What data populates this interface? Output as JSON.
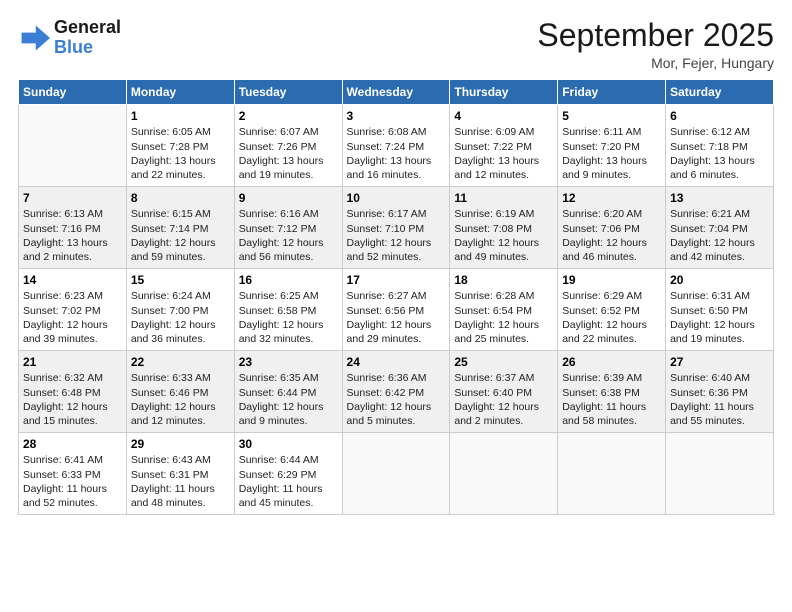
{
  "logo": {
    "line1": "General",
    "line2": "Blue"
  },
  "title": "September 2025",
  "location": "Mor, Fejer, Hungary",
  "days_header": [
    "Sunday",
    "Monday",
    "Tuesday",
    "Wednesday",
    "Thursday",
    "Friday",
    "Saturday"
  ],
  "weeks": [
    [
      {
        "day": "",
        "info": ""
      },
      {
        "day": "1",
        "info": "Sunrise: 6:05 AM\nSunset: 7:28 PM\nDaylight: 13 hours\nand 22 minutes."
      },
      {
        "day": "2",
        "info": "Sunrise: 6:07 AM\nSunset: 7:26 PM\nDaylight: 13 hours\nand 19 minutes."
      },
      {
        "day": "3",
        "info": "Sunrise: 6:08 AM\nSunset: 7:24 PM\nDaylight: 13 hours\nand 16 minutes."
      },
      {
        "day": "4",
        "info": "Sunrise: 6:09 AM\nSunset: 7:22 PM\nDaylight: 13 hours\nand 12 minutes."
      },
      {
        "day": "5",
        "info": "Sunrise: 6:11 AM\nSunset: 7:20 PM\nDaylight: 13 hours\nand 9 minutes."
      },
      {
        "day": "6",
        "info": "Sunrise: 6:12 AM\nSunset: 7:18 PM\nDaylight: 13 hours\nand 6 minutes."
      }
    ],
    [
      {
        "day": "7",
        "info": "Sunrise: 6:13 AM\nSunset: 7:16 PM\nDaylight: 13 hours\nand 2 minutes."
      },
      {
        "day": "8",
        "info": "Sunrise: 6:15 AM\nSunset: 7:14 PM\nDaylight: 12 hours\nand 59 minutes."
      },
      {
        "day": "9",
        "info": "Sunrise: 6:16 AM\nSunset: 7:12 PM\nDaylight: 12 hours\nand 56 minutes."
      },
      {
        "day": "10",
        "info": "Sunrise: 6:17 AM\nSunset: 7:10 PM\nDaylight: 12 hours\nand 52 minutes."
      },
      {
        "day": "11",
        "info": "Sunrise: 6:19 AM\nSunset: 7:08 PM\nDaylight: 12 hours\nand 49 minutes."
      },
      {
        "day": "12",
        "info": "Sunrise: 6:20 AM\nSunset: 7:06 PM\nDaylight: 12 hours\nand 46 minutes."
      },
      {
        "day": "13",
        "info": "Sunrise: 6:21 AM\nSunset: 7:04 PM\nDaylight: 12 hours\nand 42 minutes."
      }
    ],
    [
      {
        "day": "14",
        "info": "Sunrise: 6:23 AM\nSunset: 7:02 PM\nDaylight: 12 hours\nand 39 minutes."
      },
      {
        "day": "15",
        "info": "Sunrise: 6:24 AM\nSunset: 7:00 PM\nDaylight: 12 hours\nand 36 minutes."
      },
      {
        "day": "16",
        "info": "Sunrise: 6:25 AM\nSunset: 6:58 PM\nDaylight: 12 hours\nand 32 minutes."
      },
      {
        "day": "17",
        "info": "Sunrise: 6:27 AM\nSunset: 6:56 PM\nDaylight: 12 hours\nand 29 minutes."
      },
      {
        "day": "18",
        "info": "Sunrise: 6:28 AM\nSunset: 6:54 PM\nDaylight: 12 hours\nand 25 minutes."
      },
      {
        "day": "19",
        "info": "Sunrise: 6:29 AM\nSunset: 6:52 PM\nDaylight: 12 hours\nand 22 minutes."
      },
      {
        "day": "20",
        "info": "Sunrise: 6:31 AM\nSunset: 6:50 PM\nDaylight: 12 hours\nand 19 minutes."
      }
    ],
    [
      {
        "day": "21",
        "info": "Sunrise: 6:32 AM\nSunset: 6:48 PM\nDaylight: 12 hours\nand 15 minutes."
      },
      {
        "day": "22",
        "info": "Sunrise: 6:33 AM\nSunset: 6:46 PM\nDaylight: 12 hours\nand 12 minutes."
      },
      {
        "day": "23",
        "info": "Sunrise: 6:35 AM\nSunset: 6:44 PM\nDaylight: 12 hours\nand 9 minutes."
      },
      {
        "day": "24",
        "info": "Sunrise: 6:36 AM\nSunset: 6:42 PM\nDaylight: 12 hours\nand 5 minutes."
      },
      {
        "day": "25",
        "info": "Sunrise: 6:37 AM\nSunset: 6:40 PM\nDaylight: 12 hours\nand 2 minutes."
      },
      {
        "day": "26",
        "info": "Sunrise: 6:39 AM\nSunset: 6:38 PM\nDaylight: 11 hours\nand 58 minutes."
      },
      {
        "day": "27",
        "info": "Sunrise: 6:40 AM\nSunset: 6:36 PM\nDaylight: 11 hours\nand 55 minutes."
      }
    ],
    [
      {
        "day": "28",
        "info": "Sunrise: 6:41 AM\nSunset: 6:33 PM\nDaylight: 11 hours\nand 52 minutes."
      },
      {
        "day": "29",
        "info": "Sunrise: 6:43 AM\nSunset: 6:31 PM\nDaylight: 11 hours\nand 48 minutes."
      },
      {
        "day": "30",
        "info": "Sunrise: 6:44 AM\nSunset: 6:29 PM\nDaylight: 11 hours\nand 45 minutes."
      },
      {
        "day": "",
        "info": ""
      },
      {
        "day": "",
        "info": ""
      },
      {
        "day": "",
        "info": ""
      },
      {
        "day": "",
        "info": ""
      }
    ]
  ]
}
